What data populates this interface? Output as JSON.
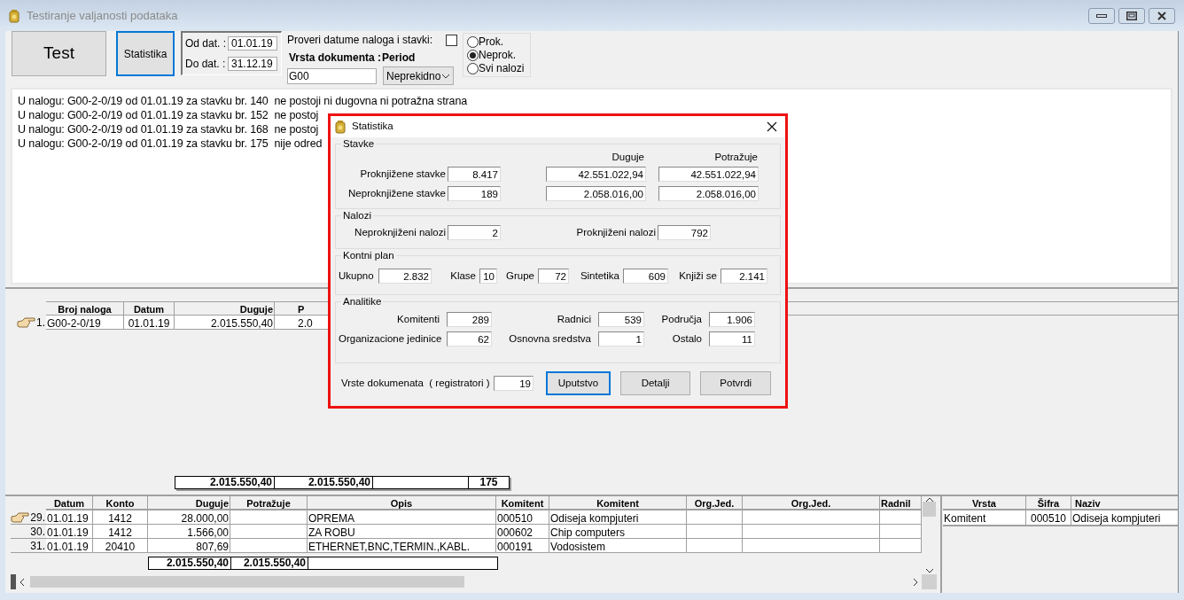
{
  "window": {
    "title": "Testiranje valjanosti podataka"
  },
  "toolbar": {
    "test_button": "Test",
    "statistika_button": "Statistika",
    "statistika_focused": true,
    "od_label": "Od dat. :",
    "od_value": "01.01.19",
    "do_label": "Do dat. :",
    "do_value": "31.12.19",
    "check_label": "Proveri datume naloga i stavki:",
    "check_checked": false,
    "vrsta_label": "Vrsta dokumenta :",
    "vrsta_value": "G00",
    "period_label": "Period",
    "period_value": "Neprekidno",
    "radios": [
      {
        "label": "Prok.",
        "selected": false
      },
      {
        "label": "Neprok.",
        "selected": true
      },
      {
        "label": "Svi nalozi",
        "selected": false
      }
    ]
  },
  "log": [
    "U nalogu: G00-2-0/19 od 01.01.19 za stavku br. 140  ne postoji ni dugovna ni potražna strana",
    "U nalogu: G00-2-0/19 od 01.01.19 za stavku br. 152  ne postoj",
    "U nalogu: G00-2-0/19 od 01.01.19 za stavku br. 168  ne postoj",
    "U nalogu: G00-2-0/19 od 01.01.19 za stavku br. 175  nije odred"
  ],
  "nalozi_table": {
    "columns": [
      "Broj naloga",
      "Datum",
      "Duguje",
      "P"
    ],
    "rows": [
      {
        "number": "1.",
        "current": true,
        "cells": [
          "G00-2-0/19",
          "01.01.19",
          "2.015.550,40",
          "2.0"
        ]
      }
    ],
    "totals": [
      "2.015.550,40",
      "2.015.550,40",
      "175"
    ]
  },
  "stavke_table": {
    "columns": [
      "Datum",
      "Konto",
      "Duguje",
      "Potražuje",
      "Opis",
      "Komitent",
      "Komitent",
      "Org.Jed.",
      "Org.Jed.",
      "Radnil"
    ],
    "rows": [
      {
        "number": "29.",
        "current": true,
        "cells": [
          "01.01.19",
          "1412",
          "28.000,00",
          "",
          "OPREMA",
          "000510",
          "Odiseja kompjuteri",
          "",
          "",
          ""
        ]
      },
      {
        "number": "30.",
        "current": false,
        "cells": [
          "01.01.19",
          "1412",
          "1.566,00",
          "",
          "ZA ROBU",
          "000602",
          "Chip computers",
          "",
          "",
          ""
        ]
      },
      {
        "number": "31.",
        "current": false,
        "cells": [
          "01.01.19",
          "20410",
          "807,69",
          "",
          "ETHERNET,BNC,TERMIN.,KABL.",
          "000191",
          "Vodosistem",
          "",
          "",
          ""
        ]
      }
    ],
    "totals": [
      "2.015.550,40",
      "2.015.550,40"
    ]
  },
  "detail_table": {
    "columns": [
      "Vrsta",
      "Šifra",
      "Naziv"
    ],
    "rows": [
      {
        "cells": [
          "Komitent",
          "000510",
          "Odiseja kompjuteri"
        ]
      }
    ]
  },
  "dialog": {
    "title": "Statistika",
    "stavke": {
      "label": "Stavke",
      "column_headers": [
        "Duguje",
        "Potražuje"
      ],
      "rows": [
        {
          "label": "Proknjižene stavke",
          "count": "8.417",
          "duguje": "42.551.022,94",
          "potrazuje": "42.551.022,94"
        },
        {
          "label": "Neproknjižene stavke",
          "count": "189",
          "duguje": "2.058.016,00",
          "potrazuje": "2.058.016,00"
        }
      ]
    },
    "nalozi": {
      "label": "Nalozi",
      "fields": [
        {
          "label": "Neproknjiženi nalozi",
          "value": "2"
        },
        {
          "label": "Proknjiženi nalozi",
          "value": "792"
        }
      ]
    },
    "kontni_plan": {
      "label": "Kontni plan",
      "fields": [
        {
          "label": "Ukupno",
          "value": "2.832"
        },
        {
          "label": "Klase",
          "value": "10"
        },
        {
          "label": "Grupe",
          "value": "72"
        },
        {
          "label": "Sintetika",
          "value": "609"
        },
        {
          "label": "Knjiži se",
          "value": "2.141"
        }
      ]
    },
    "analitike": {
      "label": "Analitike",
      "fields": [
        {
          "label": "Komitenti",
          "value": "289"
        },
        {
          "label": "Radnici",
          "value": "539"
        },
        {
          "label": "Područja",
          "value": "1.906"
        },
        {
          "label": "Organizacione jedinice",
          "value": "62"
        },
        {
          "label": "Osnovna sredstva",
          "value": "1"
        },
        {
          "label": "Ostalo",
          "value": "11"
        }
      ]
    },
    "vrste": {
      "label": "Vrste dokumenata  ( registratori )",
      "value": "19"
    },
    "buttons": [
      {
        "label": "Uputstvo",
        "focused": true
      },
      {
        "label": "Detalji",
        "focused": false
      },
      {
        "label": "Potvrdi",
        "focused": false
      }
    ]
  }
}
